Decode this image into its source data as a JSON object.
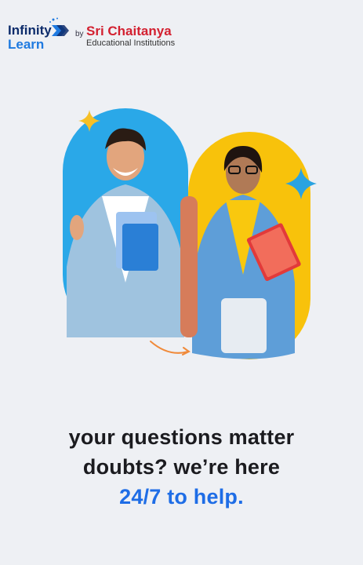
{
  "brand": {
    "infinity_line1": "Infinity",
    "infinity_line2": "Learn",
    "by": "by",
    "partner_name": "Sri Chaitanya",
    "partner_subtitle": "Educational Institutions"
  },
  "headline": {
    "line1": "your questions matter",
    "line2": "doubts? we’re here",
    "line3": "24/7 to help."
  },
  "colors": {
    "background": "#eef0f4",
    "accent_blue": "#1e6de6",
    "brand_red": "#d32030",
    "pill_blue": "#2aa8e8",
    "pill_yellow": "#f8c20b",
    "sparkle_yellow": "#f6c026",
    "sparkle_blue": "#2aa3e0"
  }
}
